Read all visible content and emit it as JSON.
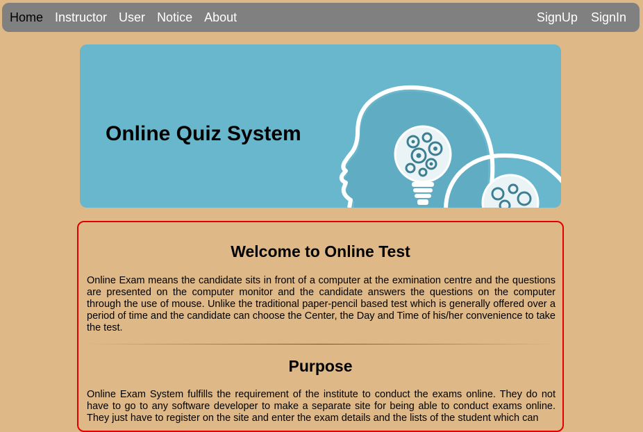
{
  "nav": {
    "left": [
      {
        "label": "Home",
        "active": true
      },
      {
        "label": "Instructor",
        "active": false
      },
      {
        "label": "User",
        "active": false
      },
      {
        "label": "Notice",
        "active": false
      },
      {
        "label": "About",
        "active": false
      }
    ],
    "right": [
      {
        "label": "SignUp"
      },
      {
        "label": "SignIn"
      }
    ]
  },
  "banner": {
    "title": "Online Quiz System",
    "image_icon": "head-lightbulb-gears-icon"
  },
  "content": {
    "welcome_heading": "Welcome to Online Test",
    "welcome_text": "Online Exam means the candidate sits in front of a computer at the exmination centre and the questions are presented on the computer monitor and the candidate answers the questions on the computer through the use of mouse. Unlike the traditional paper-pencil based test which is generally offered over a period of time and the candidate can choose the Center, the Day and Time of his/her convenience to take the test.",
    "purpose_heading": "Purpose",
    "purpose_text": "Online Exam System fulfills the requirement of the institute to conduct the exams online. They do not have to go to any software developer to make a separate site for being able to conduct exams online. They just have to register on the site and enter the exam details and the lists of the student which can"
  },
  "colors": {
    "page_background": "#DEB887",
    "navbar_background": "#808080",
    "banner_background": "#69B7CC",
    "content_border": "#E00000"
  }
}
